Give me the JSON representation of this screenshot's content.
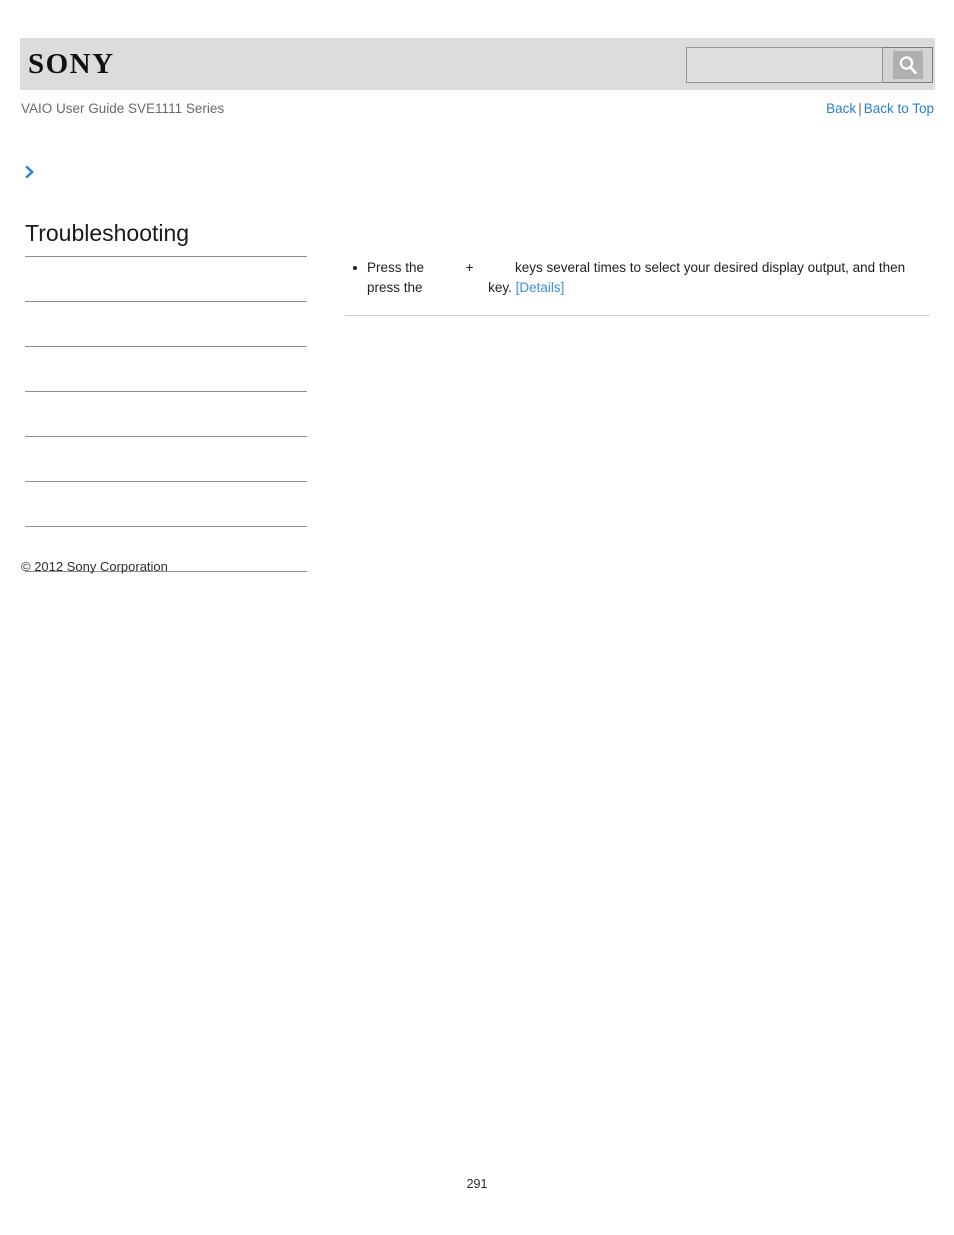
{
  "header": {
    "logo_text": "SONY",
    "search": {
      "value": "",
      "placeholder": "",
      "button_icon": "search-icon"
    }
  },
  "subheader": {
    "guide_title": "VAIO User Guide SVE1111 Series",
    "back_label": "Back",
    "separator": "|",
    "back_to_top_label": "Back to Top"
  },
  "breadcrumb": {
    "icon": "chevron-right-icon",
    "text": ""
  },
  "sidebar": {
    "title": "Troubleshooting",
    "items": [
      {
        "label": ""
      },
      {
        "label": ""
      },
      {
        "label": ""
      },
      {
        "label": ""
      },
      {
        "label": ""
      },
      {
        "label": ""
      },
      {
        "label": ""
      }
    ]
  },
  "content": {
    "bullets": [
      {
        "part1": "Press the",
        "part2": "+",
        "part3": "keys several times to select your desired display output, and then press the",
        "part4": "key.",
        "link_label": "[Details]"
      }
    ]
  },
  "footer": {
    "copyright": "© 2012 Sony Corporation",
    "page_number": "291"
  },
  "colors": {
    "header_bg": "#dcdcdc",
    "link_blue": "#2a7ed3",
    "details_blue": "#3d8fdd",
    "chevron_blue": "#2e8bc8",
    "rule_gray": "#8e8e8e",
    "content_rule_gray": "#cfcfcf",
    "muted_text": "#6a6a6a"
  }
}
